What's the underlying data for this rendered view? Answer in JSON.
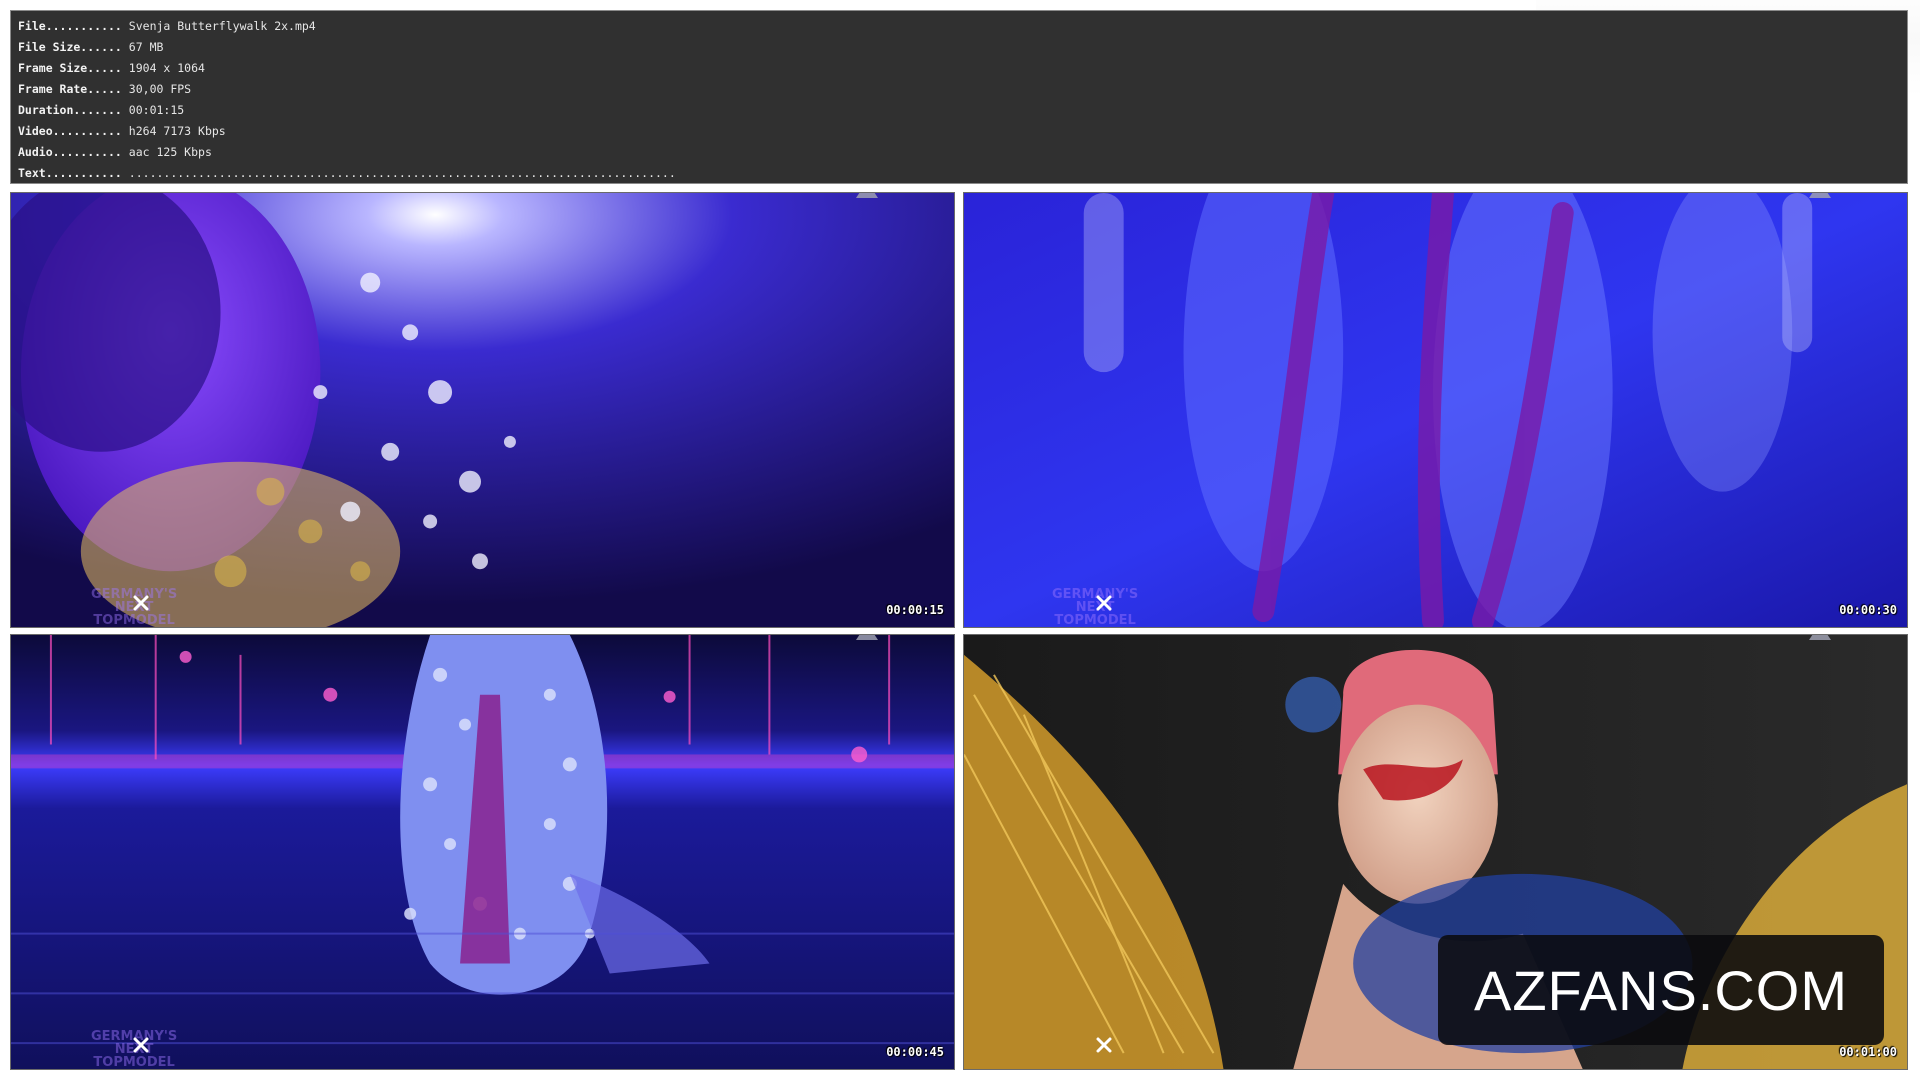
{
  "info": {
    "rows": [
      {
        "key": "File...........",
        "value": "Svenja Butterflywalk 2x.mp4"
      },
      {
        "key": "File Size......",
        "value": "67 MB"
      },
      {
        "key": "Frame Size.....",
        "value": "1904 x 1064"
      },
      {
        "key": "Frame Rate.....",
        "value": "30,00 FPS"
      },
      {
        "key": "Duration.......",
        "value": "00:01:15"
      },
      {
        "key": "Video..........",
        "value": "h264 7173 Kbps"
      },
      {
        "key": "Audio..........",
        "value": "aac 125 Kbps"
      },
      {
        "key": "Text...........",
        "value": "..............................................................................."
      }
    ]
  },
  "thumbnails": [
    {
      "timecode": "00:00:15",
      "logo": "GERMANY'S\nNEXT\nTOPMODEL"
    },
    {
      "timecode": "00:00:30",
      "logo": "GERMANY'S\nNEXT\nTOPMODEL"
    },
    {
      "timecode": "00:00:45",
      "logo": "GERMANY'S\nNEXT\nTOPMODEL"
    },
    {
      "timecode": "00:01:00",
      "logo": ""
    }
  ],
  "watermark": {
    "text": "AZFANS.COM"
  },
  "icons": {
    "close": "close-x-icon",
    "tab": "tab-marker-icon"
  },
  "colors": {
    "panel_bg": "#303030",
    "panel_text": "#e8e8e8",
    "scene_blue": "#2a1fd8",
    "scene_violet": "#6a2bff",
    "scene_gold": "#d9a431",
    "scene_red": "#c81e2a"
  }
}
